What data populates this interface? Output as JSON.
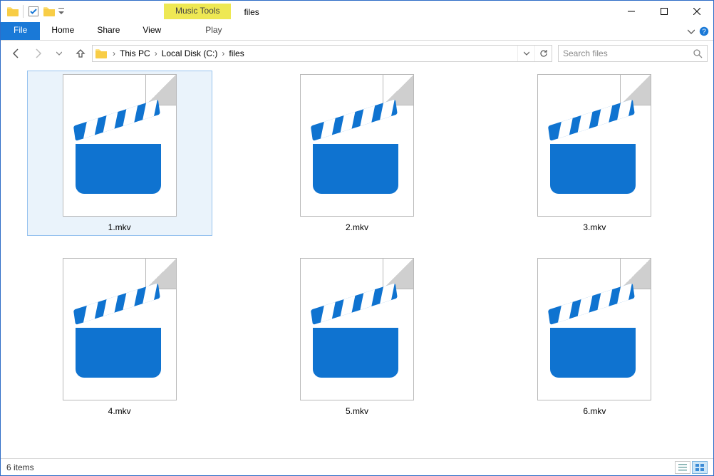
{
  "window": {
    "title": "files"
  },
  "ribbon_context": {
    "label": "Music Tools",
    "tab": "Play"
  },
  "tabs": {
    "file": "File",
    "home": "Home",
    "share": "Share",
    "view": "View"
  },
  "breadcrumb": {
    "segments": [
      "This PC",
      "Local Disk (C:)",
      "files"
    ]
  },
  "search": {
    "placeholder": "Search files"
  },
  "files": [
    {
      "name": "1.mkv",
      "selected": true
    },
    {
      "name": "2.mkv",
      "selected": false
    },
    {
      "name": "3.mkv",
      "selected": false
    },
    {
      "name": "4.mkv",
      "selected": false
    },
    {
      "name": "5.mkv",
      "selected": false
    },
    {
      "name": "6.mkv",
      "selected": false
    }
  ],
  "status": {
    "text": "6 items"
  }
}
